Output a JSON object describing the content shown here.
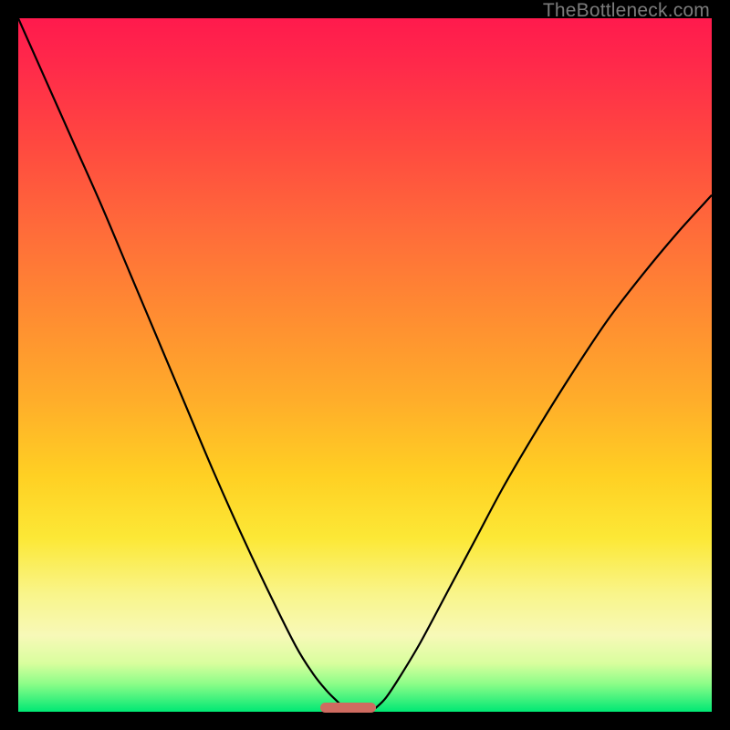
{
  "watermark": {
    "text": "TheBottleneck.com"
  },
  "gradient": {
    "top": "#ff1a4d",
    "mid": "#ffd023",
    "bottom": "#00e874"
  },
  "marker": {
    "color": "#cf6b60",
    "x_start_frac": 0.435,
    "x_end_frac": 0.516,
    "y_frac": 0.993
  },
  "chart_data": {
    "type": "line",
    "title": "",
    "xlabel": "",
    "ylabel": "",
    "xlim": [
      0,
      100
    ],
    "ylim": [
      0,
      100
    ],
    "grid": false,
    "legend": false,
    "series": [
      {
        "name": "left-curve",
        "x": [
          0.0,
          4.0,
          8.0,
          12.0,
          16.0,
          20.0,
          24.0,
          28.0,
          32.0,
          36.0,
          40.0,
          42.5,
          44.5,
          46.0,
          47.0
        ],
        "y": [
          100.0,
          91.0,
          82.0,
          73.0,
          63.5,
          54.0,
          44.5,
          35.0,
          26.0,
          17.5,
          9.5,
          5.5,
          3.0,
          1.5,
          0.5
        ]
      },
      {
        "name": "right-curve",
        "x": [
          51.5,
          53.0,
          55.0,
          58.0,
          62.0,
          66.0,
          70.0,
          75.0,
          80.0,
          85.0,
          90.0,
          95.0,
          100.0
        ],
        "y": [
          0.5,
          2.0,
          5.0,
          10.0,
          17.5,
          25.0,
          32.5,
          41.0,
          49.0,
          56.5,
          63.0,
          69.0,
          74.5
        ]
      }
    ],
    "annotations": [
      {
        "type": "bar-marker",
        "x_start": 43.5,
        "x_end": 51.6,
        "y": 0.3,
        "color": "#cf6b60"
      }
    ]
  }
}
